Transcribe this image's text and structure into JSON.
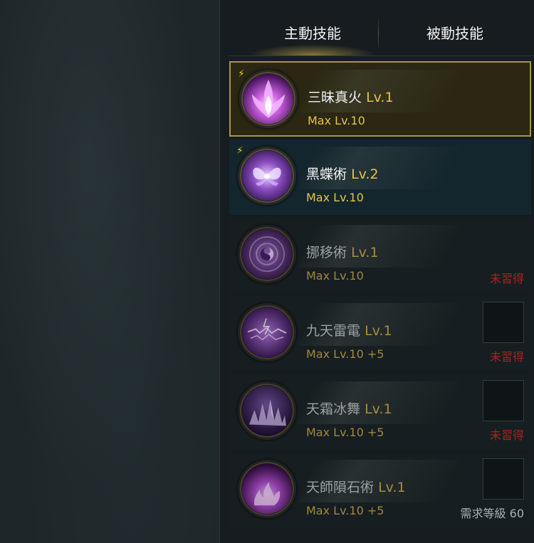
{
  "tabs": {
    "active": "主動技能",
    "inactive": "被動技能"
  },
  "skills": [
    {
      "name": "三昧真火",
      "level": "Lv.1",
      "max": "Max Lv.10",
      "status": "",
      "state": "selected",
      "icon": "purple-flame-burst-icon"
    },
    {
      "name": "黑蝶術",
      "level": "Lv.2",
      "max": "Max Lv.10",
      "status": "",
      "state": "learned",
      "icon": "purple-butterfly-icon"
    },
    {
      "name": "挪移術",
      "level": "Lv.1",
      "max": "Max Lv.10",
      "status": "未習得",
      "state": "locked",
      "icon": "yin-yang-vortex-icon"
    },
    {
      "name": "九天雷電",
      "level": "Lv.1",
      "max": "Max Lv.10 +5",
      "status": "未習得",
      "state": "locked",
      "icon": "purple-lightning-icon"
    },
    {
      "name": "天霜冰舞",
      "level": "Lv.1",
      "max": "Max Lv.10 +5",
      "status": "未習得",
      "state": "locked",
      "icon": "ice-crystals-icon"
    },
    {
      "name": "天師隕石術",
      "level": "Lv.1",
      "max": "Max Lv.10 +5",
      "status": "需求等級 60",
      "state": "locked",
      "icon": "meteor-fire-icon"
    }
  ],
  "colors": {
    "accent": "#e7c24a",
    "selected_border": "#a8964f",
    "locked_text": "#a9231c"
  }
}
